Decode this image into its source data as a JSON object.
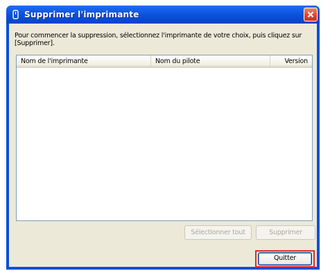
{
  "window": {
    "title": "Supprimer l'imprimante"
  },
  "instructions": "Pour commencer la suppression, sélectionnez l'imprimante de votre choix, puis cliquez sur [Supprimer].",
  "printer_list": {
    "columns": [
      "Nom de l'imprimante",
      "Nom du pilote",
      "Version"
    ],
    "rows": []
  },
  "buttons": {
    "select_all": "Sélectionner tout",
    "delete": "Supprimer",
    "quit": "Quitter"
  },
  "colors": {
    "titlebar": "#0a4fd6",
    "client_background": "#ece9d8",
    "close_button": "#d9452a",
    "highlight": "#e0282f"
  }
}
